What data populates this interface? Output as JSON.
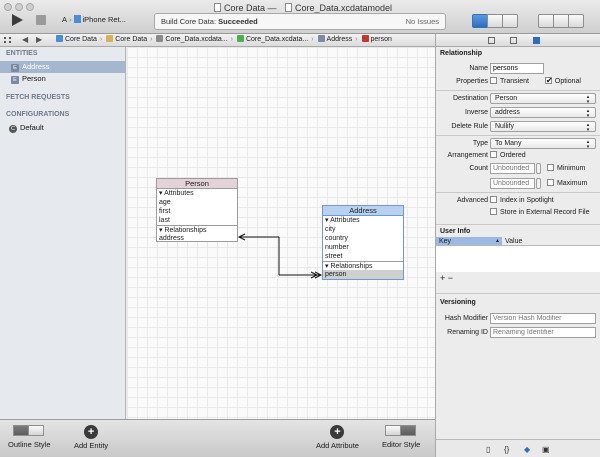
{
  "window": {
    "project": "Core Data",
    "dash": "—",
    "document": "Core_Data.xcdatamodel"
  },
  "toolbar": {
    "scheme_target": "A",
    "scheme_device": "iPhone Ret...",
    "activity_prefix": "Build Core Data:",
    "activity_status": "Succeeded",
    "issues": "No Issues"
  },
  "jumpbar": {
    "crumbs": [
      {
        "label": "Core Data",
        "icon": "project-icon",
        "color": "#4a8ed8"
      },
      {
        "label": "Core Data",
        "icon": "folder-icon",
        "color": "#d8b25a"
      },
      {
        "label": "Core_Data.xcdatа...",
        "icon": "model-file-icon",
        "color": "#8a8a8a"
      },
      {
        "label": "Core_Data.xcdatа...",
        "icon": "model-version-icon",
        "color": "#4caf50"
      },
      {
        "label": "Address",
        "icon": "entity-icon",
        "color": "#7b8aa3"
      },
      {
        "label": "person",
        "icon": "relationship-icon",
        "color": "#c0392b"
      }
    ]
  },
  "outline": {
    "entities_header": "ENTITIES",
    "entities": [
      {
        "badge": "E",
        "label": "Address",
        "selected": true
      },
      {
        "badge": "E",
        "label": "Person",
        "selected": false
      }
    ],
    "fetch_header": "FETCH REQUESTS",
    "config_header": "CONFIGURATIONS",
    "configurations": [
      {
        "badge": "C",
        "label": "Default"
      }
    ]
  },
  "canvas": {
    "person": {
      "name": "Person",
      "attributes_label": "Attributes",
      "attributes": [
        "age",
        "first",
        "last"
      ],
      "relationships_label": "Relationships",
      "relationships": [
        "address"
      ]
    },
    "address": {
      "name": "Address",
      "attributes_label": "Attributes",
      "attributes": [
        "city",
        "country",
        "number",
        "street"
      ],
      "relationships_label": "Relationships",
      "relationships": [
        "person"
      ]
    }
  },
  "bottombar": {
    "outline_style": "Outline Style",
    "add_entity": "Add Entity",
    "add_attribute": "Add Attribute",
    "editor_style": "Editor Style",
    "plus": "+"
  },
  "inspector": {
    "section_title": "Relationship",
    "name_label": "Name",
    "name_value": "persons",
    "properties_label": "Properties",
    "transient": "Transient",
    "transient_checked": false,
    "optional": "Optional",
    "optional_checked": true,
    "destination_label": "Destination",
    "destination_value": "Person",
    "inverse_label": "Inverse",
    "inverse_value": "address",
    "delete_rule_label": "Delete Rule",
    "delete_rule_value": "Nullify",
    "type_label": "Type",
    "type_value": "To Many",
    "arrangement_label": "Arrangement",
    "ordered": "Ordered",
    "count_label": "Count",
    "count_placeholder": "Unbounded",
    "minimum": "Minimum",
    "maximum": "Maximum",
    "advanced_label": "Advanced",
    "index_spotlight": "Index in Spotlight",
    "store_external": "Store in External Record File",
    "user_info_title": "User Info",
    "key_col": "Key",
    "value_col": "Value",
    "add_remove": "+ −",
    "versioning_title": "Versioning",
    "hash_modifier_label": "Hash Modifier",
    "hash_modifier_placeholder": "Version Hash Modifier",
    "renaming_id_label": "Renaming ID",
    "renaming_id_placeholder": "Renaming Identifier",
    "library_tabs": [
      "file-template-icon",
      "code-snippet-icon",
      "object-library-icon",
      "media-library-icon"
    ]
  }
}
